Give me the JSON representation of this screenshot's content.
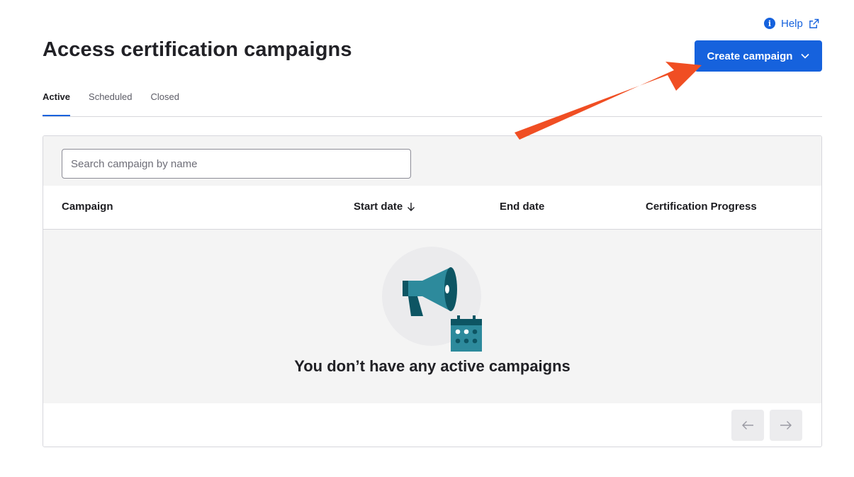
{
  "header": {
    "title": "Access certification campaigns",
    "help_label": "Help",
    "create_button_label": "Create campaign"
  },
  "tabs": [
    {
      "label": "Active",
      "active": true
    },
    {
      "label": "Scheduled",
      "active": false
    },
    {
      "label": "Closed",
      "active": false
    }
  ],
  "search": {
    "placeholder": "Search campaign by name",
    "value": ""
  },
  "table": {
    "columns": [
      {
        "label": "Campaign",
        "sorted": false
      },
      {
        "label": "Start date",
        "sorted": true,
        "sort_direction": "descending"
      },
      {
        "label": "End date",
        "sorted": false
      },
      {
        "label": "Certification Progress",
        "sorted": false
      }
    ]
  },
  "empty_state": {
    "message": "You don’t have any active campaigns"
  },
  "colors": {
    "accent": "#1662dd",
    "annotation_arrow": "#f04e23",
    "illustration_teal": "#2d8a9c",
    "illustration_dark": "#0d5563"
  },
  "icons": [
    "info-icon",
    "external-link-icon",
    "chevron-down-icon",
    "sort-down-arrow-icon",
    "megaphone-icon",
    "calendar-icon",
    "arrow-left-icon",
    "arrow-right-icon"
  ]
}
